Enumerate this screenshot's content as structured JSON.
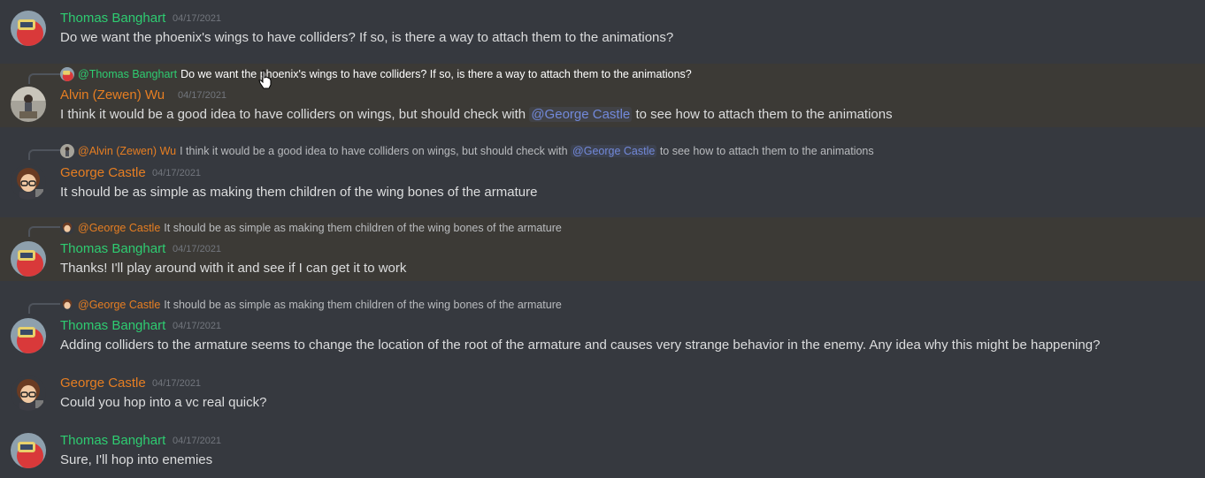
{
  "messages": [
    {
      "author": "Thomas Banghart",
      "timestamp": "04/17/2021",
      "text": "Do we want the phoenix's wings to have colliders? If so, is there a way to attach them to the animations?"
    },
    {
      "reply": {
        "author": "@Thomas Banghart",
        "text": "Do we want the phoenix's wings to have colliders? If so, is there a way to attach them to the animations?"
      },
      "author": "Alvin (Zewen) Wu",
      "timestamp": "04/17/2021",
      "text_before": "I think it would be a good idea to have colliders on wings, but should check with ",
      "mention": "@George Castle",
      "text_after": " to see how to attach them to the animations"
    },
    {
      "reply": {
        "author": "@Alvin (Zewen) Wu",
        "text_before": "I think it would be a good idea to have colliders on wings, but should check with ",
        "mention": "@George Castle",
        "text_after": " to see how to attach them to the animations"
      },
      "author": "George Castle",
      "timestamp": "04/17/2021",
      "text": "It should be as simple as making them children of the wing bones of the armature"
    },
    {
      "reply": {
        "author": "@George Castle",
        "text": "It should be as simple as making them children of the wing bones of the armature"
      },
      "author": "Thomas Banghart",
      "timestamp": "04/17/2021",
      "text": "Thanks! I'll play around with it and see if I can get it to work"
    },
    {
      "reply": {
        "author": "@George Castle",
        "text": "It should be as simple as making them children of the wing bones of the armature"
      },
      "author": "Thomas Banghart",
      "timestamp": "04/17/2021",
      "text": "Adding colliders to the armature seems to change the location of the root of the armature and causes very strange behavior in the enemy. Any idea why this might be happening?"
    },
    {
      "author": "George Castle",
      "timestamp": "04/17/2021",
      "text": "Could you hop into a vc real quick?"
    },
    {
      "author": "Thomas Banghart",
      "timestamp": "04/17/2021",
      "text": "Sure, I'll hop into enemies"
    }
  ],
  "colors": {
    "background": "#36393f",
    "thomas": "#2ecc71",
    "george": "#e67e22",
    "alvin": "#e67e22",
    "mention": "#7289da",
    "timestamp": "#72767d",
    "text": "#dcddde"
  },
  "icons": [
    "thomas-avatar-icon",
    "alvin-avatar-icon",
    "george-avatar-icon",
    "hand-cursor-icon"
  ]
}
